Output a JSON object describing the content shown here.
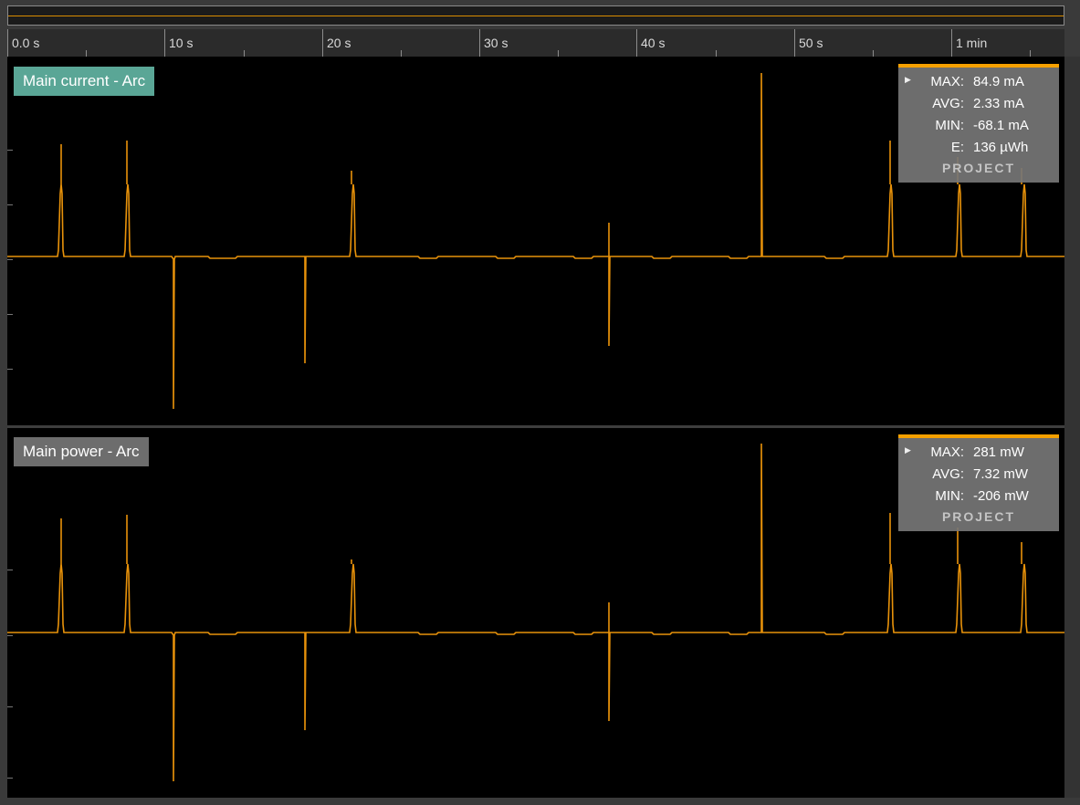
{
  "timeline": {
    "ticks": [
      "0.0 s",
      "10 s",
      "20 s",
      "30 s",
      "40 s",
      "50 s",
      "1 min"
    ]
  },
  "colors": {
    "trace": "#e8920a",
    "accent": "#f5a000",
    "current_label_bg": "#5aa696",
    "power_label_bg": "#6d6d6d"
  },
  "lanes": {
    "current": {
      "label": "Main current - Arc",
      "stats": [
        {
          "key": "MAX:",
          "value": "84.9 mA"
        },
        {
          "key": "AVG:",
          "value": "2.33 mA"
        },
        {
          "key": "MIN:",
          "value": "-68.1 mA"
        },
        {
          "key": "E:",
          "value": "136 µWh"
        }
      ],
      "project": "PROJECT"
    },
    "power": {
      "label": "Main power - Arc",
      "stats": [
        {
          "key": "MAX:",
          "value": "281 mW"
        },
        {
          "key": "AVG:",
          "value": "7.32 mW"
        },
        {
          "key": "MIN:",
          "value": "-206 mW"
        }
      ],
      "project": "PROJECT"
    }
  }
}
